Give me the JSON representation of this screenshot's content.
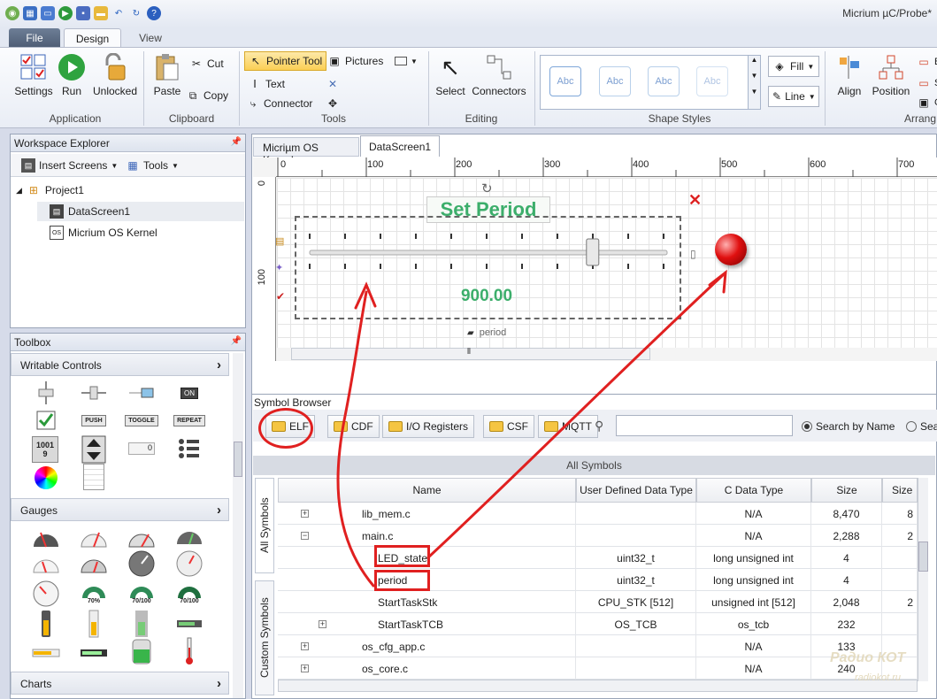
{
  "app": {
    "title": "Micrium µC/Probe*"
  },
  "tabs": {
    "file": "File",
    "design": "Design",
    "view": "View"
  },
  "ribbon": {
    "settings": "Settings",
    "run": "Run",
    "unlocked": "Unlocked",
    "application": "Application",
    "paste": "Paste",
    "cut": "Cut",
    "copy": "Copy",
    "clipboard": "Clipboard",
    "pointer_tool": "Pointer Tool",
    "pictures": "Pictures",
    "text": "Text",
    "connector": "Connector",
    "tools": "Tools",
    "select": "Select",
    "connectors": "Connectors",
    "editing": "Editing",
    "style_sample": "Abc",
    "shape_styles": "Shape Styles",
    "fill": "Fill",
    "line": "Line",
    "align": "Align",
    "position": "Position",
    "arrange": "Arrang"
  },
  "workspace": {
    "title": "Workspace Explorer",
    "insert_screens": "Insert Screens",
    "tools": "Tools",
    "items": [
      "Project1",
      "DataScreen1",
      "Micrium OS Kernel"
    ]
  },
  "toolbox": {
    "title": "Toolbox",
    "categories": [
      "Writable Controls",
      "Gauges",
      "Charts"
    ],
    "push": "PUSH",
    "toggle": "TOGGLE",
    "repeat": "REPEAT",
    "on": "ON",
    "num_top": "1001",
    "num_bottom": "9",
    "zero": "0",
    "gauge_a": "70%",
    "gauge_b": "70/100",
    "gauge_c": "70/100"
  },
  "doc_tabs": [
    "Micriµm OS Kernel",
    "DataScreen1"
  ],
  "ruler": {
    "h": [
      "0",
      "100",
      "200",
      "300",
      "400",
      "500",
      "600",
      "700"
    ],
    "v": [
      "0",
      "100"
    ]
  },
  "screen": {
    "title": "Set Period",
    "value": "900.00",
    "label": "period",
    "slider_level": 0.82
  },
  "symbol_browser": {
    "title": "Symbol Browser",
    "buttons": [
      "ELF",
      "CDF",
      "I/O Registers",
      "CSF",
      "MQTT"
    ],
    "search_mode": "Search by Name",
    "search_mode2": "Sea",
    "all_symbols": "All Symbols",
    "side_tabs": [
      "All Symbols",
      "Custom Symbols"
    ],
    "columns": [
      "Name",
      "User Defined Data Type",
      "C Data Type",
      "Size",
      "Size"
    ],
    "rows": [
      {
        "exp": "+",
        "name": "lib_mem.c",
        "udt": "",
        "ctype": "N/A",
        "size": "8,470",
        "size2": "8"
      },
      {
        "exp": "−",
        "name": "main.c",
        "udt": "",
        "ctype": "N/A",
        "size": "2,288",
        "size2": "2"
      },
      {
        "exp": "",
        "name": "LED_state",
        "udt": "uint32_t",
        "ctype": "long unsigned int",
        "size": "4",
        "size2": ""
      },
      {
        "exp": "",
        "name": "period",
        "udt": "uint32_t",
        "ctype": "long unsigned int",
        "size": "4",
        "size2": ""
      },
      {
        "exp": "",
        "name": "StartTaskStk",
        "udt": "CPU_STK [512]",
        "ctype": "unsigned int [512]",
        "size": "2,048",
        "size2": "2"
      },
      {
        "exp": "+",
        "name": "StartTaskTCB",
        "udt": "OS_TCB",
        "ctype": "os_tcb",
        "size": "232",
        "size2": ""
      },
      {
        "exp": "+",
        "name": "os_cfg_app.c",
        "udt": "",
        "ctype": "N/A",
        "size": "133",
        "size2": ""
      },
      {
        "exp": "+",
        "name": "os_core.c",
        "udt": "",
        "ctype": "N/A",
        "size": "240",
        "size2": ""
      }
    ]
  },
  "watermark": {
    "line1": "Радио КОТ",
    "line2": "radiokot.ru"
  }
}
